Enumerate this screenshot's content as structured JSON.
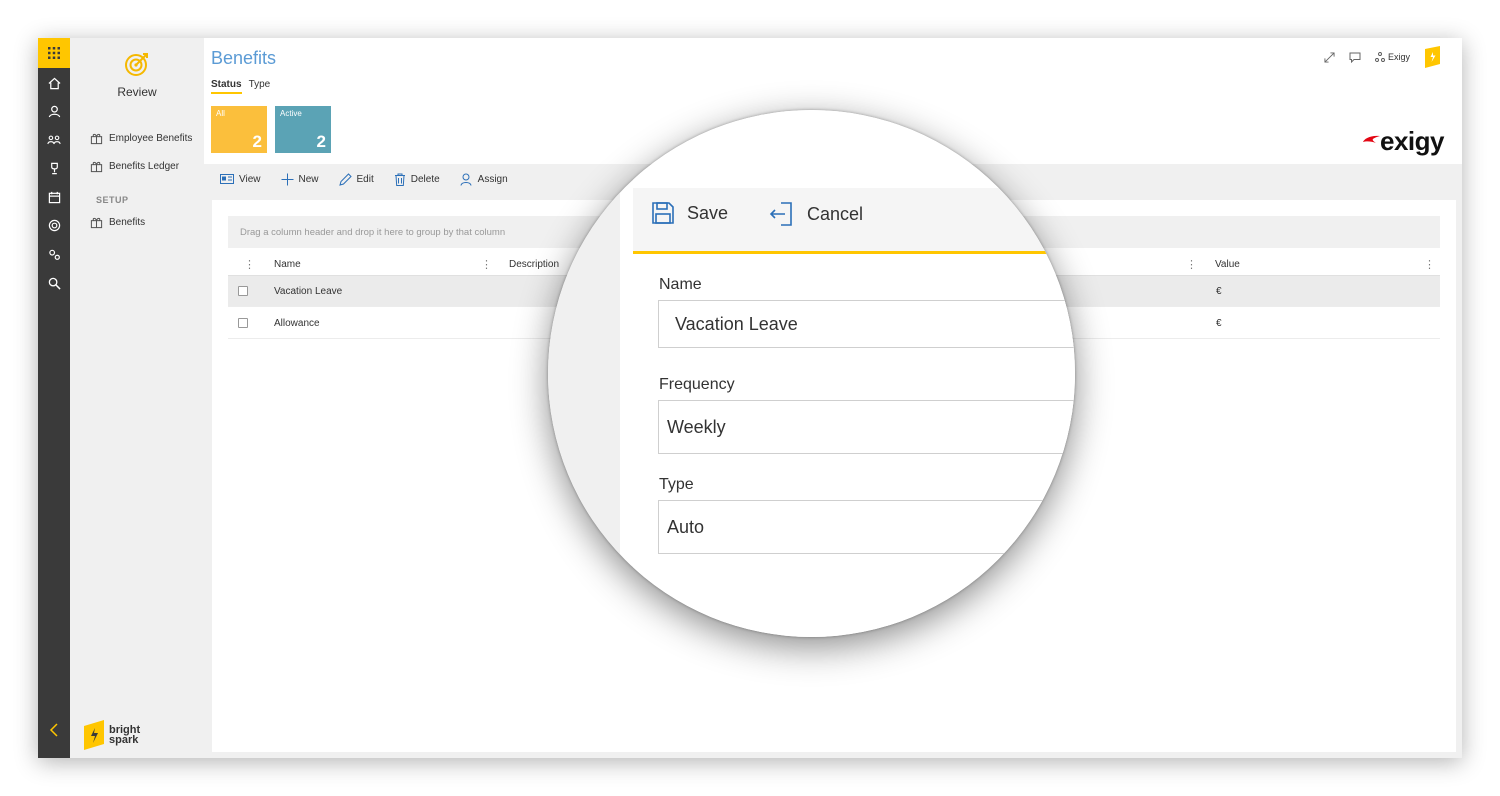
{
  "nav": {
    "module_label": "Review",
    "items": [
      {
        "label": "Employee Benefits"
      },
      {
        "label": "Benefits Ledger"
      }
    ],
    "section_label": "SETUP",
    "setup_items": [
      {
        "label": "Benefits"
      }
    ],
    "brand_line1": "bright",
    "brand_line2": "spark"
  },
  "header": {
    "title": "Benefits",
    "tabs": [
      {
        "label": "Status",
        "active": true
      },
      {
        "label": "Type",
        "active": false
      }
    ],
    "user_name": "Exigy",
    "logo_text": "exigy"
  },
  "tiles": [
    {
      "label": "All",
      "count": "2",
      "color": "#fbbf3c"
    },
    {
      "label": "Active",
      "count": "2",
      "color": "#5ba3b5"
    }
  ],
  "toolbar": {
    "view": "View",
    "new": "New",
    "edit": "Edit",
    "delete": "Delete",
    "assign": "Assign"
  },
  "grid": {
    "group_hint": "Drag a column header and drop it here to group by that column",
    "columns": {
      "name": "Name",
      "description": "Description",
      "value": "Value"
    },
    "rows": [
      {
        "name": "Vacation Leave",
        "value": "€",
        "selected": true
      },
      {
        "name": "Allowance",
        "value": "€",
        "selected": false
      }
    ]
  },
  "form": {
    "save_label": "Save",
    "cancel_label": "Cancel",
    "name_label": "Name",
    "name_value": "Vacation Leave",
    "frequency_label": "Frequency",
    "frequency_value": "Weekly",
    "type_label": "Type",
    "type_value": "Auto"
  },
  "colors": {
    "accent": "#ffc600",
    "title_blue": "#5b9bd5",
    "rail": "#3a3a3a"
  }
}
